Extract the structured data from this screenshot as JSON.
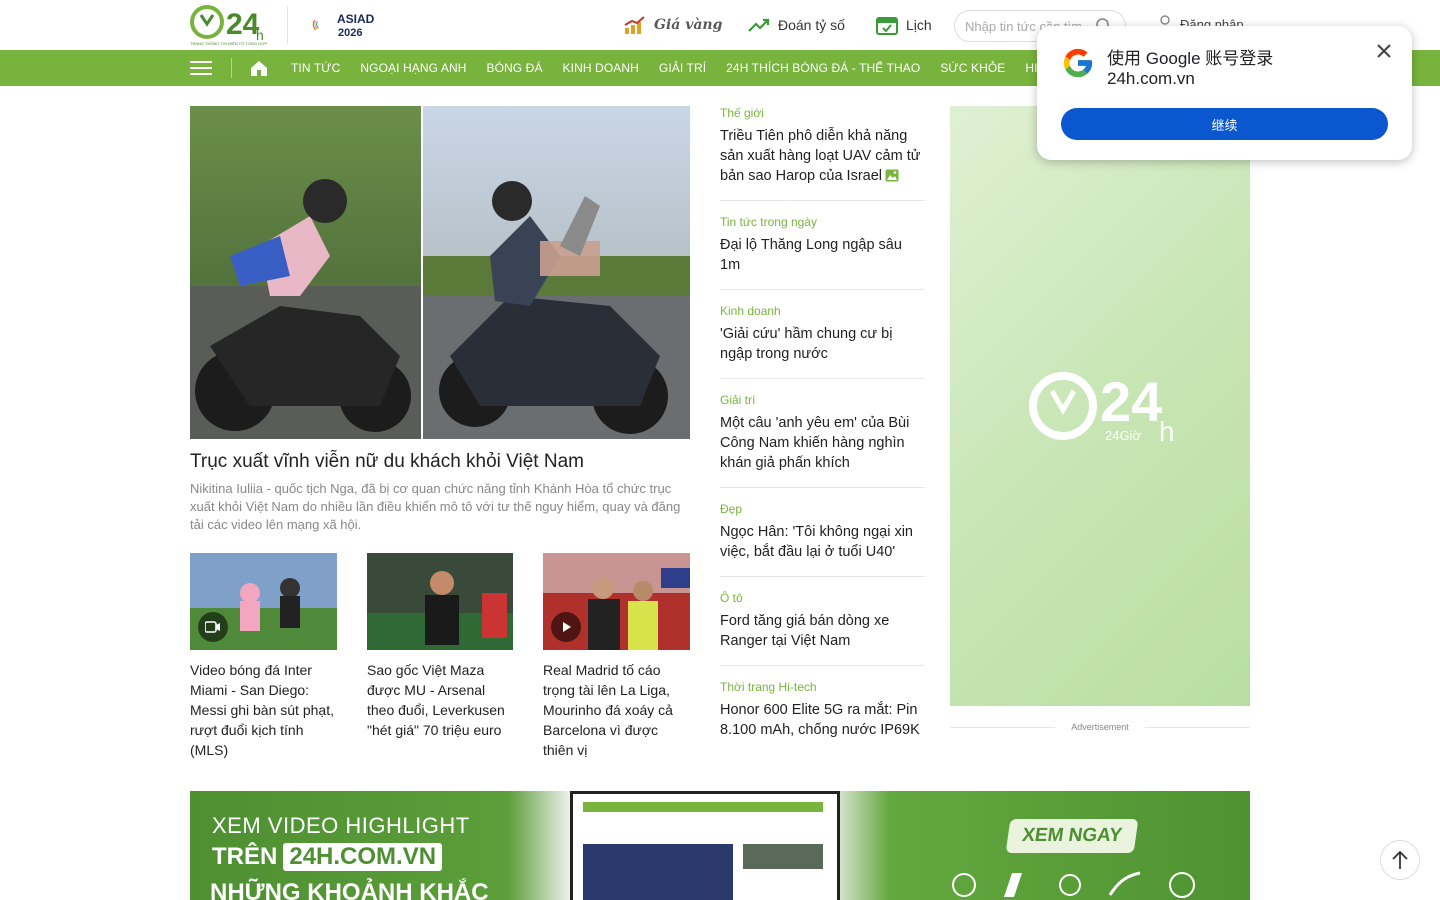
{
  "header": {
    "logo_text": "TRANG THÔNG TIN ĐIỆN TỬ TỔNG HỢP",
    "asiad_line1": "ASIAD",
    "asiad_line2": "2026",
    "tools": {
      "gold": "Giá vàng",
      "guess": "Đoán tỷ số",
      "calendar": "Lịch"
    },
    "search_placeholder": "Nhập tin tức cần tìm",
    "login": "Đăng nhập"
  },
  "nav": {
    "items": [
      "TIN TỨC",
      "NGOẠI HẠNG ANH",
      "BÓNG ĐÁ",
      "KINH DOANH",
      "GIẢI TRÍ",
      "24H THÍCH BÓNG ĐÁ - THỂ THAO",
      "SỨC KHỎE",
      "HI-TECH"
    ]
  },
  "hero": {
    "title": "Trục xuất vĩnh viễn nữ du khách khỏi Việt Nam",
    "description": "Nikitina Iuliia - quốc tịch Nga, đã bị cơ quan chức năng tỉnh Khánh Hòa tổ chức trục xuất khỏi Việt Nam do nhiều lần điều khiển mô tô với tư thế nguy hiểm, quay và đăng tải các video lên mạng xã hội."
  },
  "thumbs": [
    {
      "title": "Video bóng đá Inter Miami - San Diego: Messi ghi bàn sút phạt, rượt đuổi kịch tính (MLS)",
      "badge": "video-icon"
    },
    {
      "title": "Sao gốc Việt Maza được MU - Arsenal theo đuổi, Leverkusen \"hét giá\" 70 triệu euro",
      "badge": ""
    },
    {
      "title": "Real Madrid tố cáo trọng tài lên La Liga, Mourinho đá xoáy cả Barcelona vì được thiên vị",
      "badge": "play-icon"
    }
  ],
  "list": [
    {
      "category": "Thế giới",
      "title": "Triều Tiên phô diễn khả năng sản xuất hàng loạt UAV cảm tử bản sao Harop của Israel"
    },
    {
      "category": "Tin tức trong ngày",
      "title": "Đại lộ Thăng Long ngập sâu 1m"
    },
    {
      "category": "Kinh doanh",
      "title": "'Giải cứu' hầm chung cư bị ngập trong nước"
    },
    {
      "category": "Giải trí",
      "title": "Một câu 'anh yêu em' của Bùi Công Nam khiến hàng nghìn khán giả phấn khích"
    },
    {
      "category": "Đẹp",
      "title": "Ngọc Hân: 'Tôi không ngại xin việc, bắt đầu lại ở tuổi U40'"
    },
    {
      "category": "Ô tô",
      "title": "Ford tăng giá bán dòng xe Ranger tại Việt Nam"
    },
    {
      "category": "Thời trang Hi-tech",
      "title": "Honor 600 Elite 5G ra mắt: Pin 8.100 mAh, chống nước IP69K"
    }
  ],
  "ad": {
    "label": "Advertisement",
    "logo_sub": "24Giờ"
  },
  "banner": {
    "line1": "XEM VIDEO HIGHLIGHT",
    "line2_prefix": "TRÊN",
    "line2_box": "24H.COM.VN",
    "line3": "NHỮNG KHOẢNH KHẮC",
    "cta": "XEM NGAY"
  },
  "google_popup": {
    "title": "使用 Google 账号登录",
    "site": "24h.com.vn",
    "button": "继续"
  },
  "colors": {
    "brand_green": "#78b43d",
    "google_blue": "#0b57d0"
  }
}
